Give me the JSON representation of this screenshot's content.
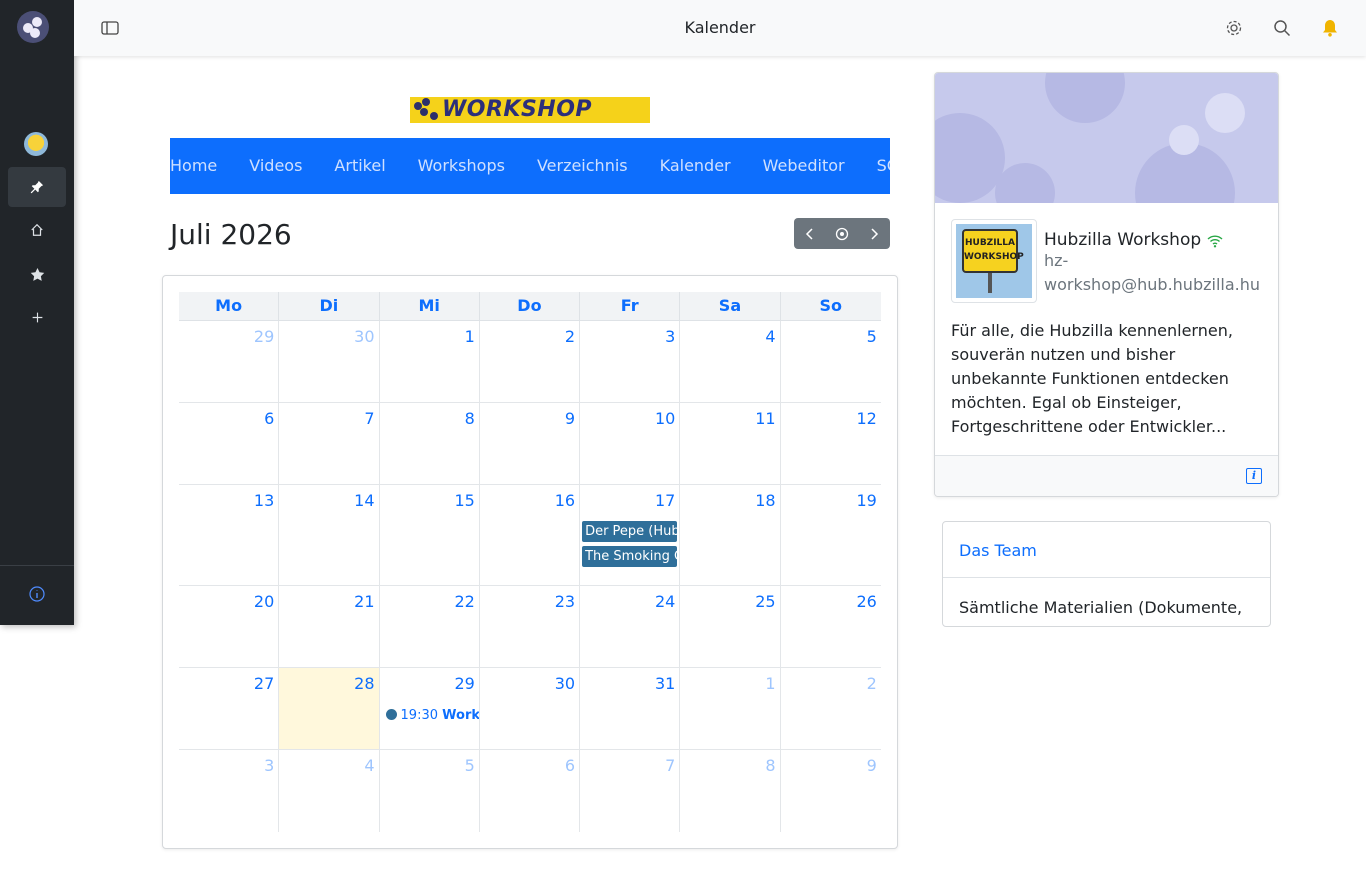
{
  "topbar": {
    "title": "Kalender"
  },
  "banner": {
    "text": "WORKSHOP"
  },
  "nav": {
    "items": [
      "Home",
      "Videos",
      "Artikel",
      "Workshops",
      "Verzeichnis",
      "Kalender",
      "Webeditor",
      "SCEd"
    ]
  },
  "calendar": {
    "month_title": "Juli 2026",
    "weekdays": [
      "Mo",
      "Di",
      "Mi",
      "Do",
      "Fr",
      "Sa",
      "So"
    ],
    "weeks": [
      [
        {
          "d": "29",
          "o": true
        },
        {
          "d": "30",
          "o": true
        },
        {
          "d": "1"
        },
        {
          "d": "2"
        },
        {
          "d": "3"
        },
        {
          "d": "4"
        },
        {
          "d": "5"
        }
      ],
      [
        {
          "d": "6"
        },
        {
          "d": "7"
        },
        {
          "d": "8"
        },
        {
          "d": "9"
        },
        {
          "d": "10"
        },
        {
          "d": "11"
        },
        {
          "d": "12"
        }
      ],
      [
        {
          "d": "13"
        },
        {
          "d": "14"
        },
        {
          "d": "15"
        },
        {
          "d": "16"
        },
        {
          "d": "17",
          "events": [
            "Der Pepe (Hub",
            "The Smoking C"
          ]
        },
        {
          "d": "18"
        },
        {
          "d": "19"
        }
      ],
      [
        {
          "d": "20"
        },
        {
          "d": "21"
        },
        {
          "d": "22"
        },
        {
          "d": "23"
        },
        {
          "d": "24"
        },
        {
          "d": "25"
        },
        {
          "d": "26"
        }
      ],
      [
        {
          "d": "27"
        },
        {
          "d": "28",
          "today": true
        },
        {
          "d": "29",
          "dot": {
            "time": "19:30",
            "title": "Works"
          }
        },
        {
          "d": "30"
        },
        {
          "d": "31"
        },
        {
          "d": "1",
          "o": true
        },
        {
          "d": "2",
          "o": true
        }
      ],
      [
        {
          "d": "3",
          "o": true
        },
        {
          "d": "4",
          "o": true
        },
        {
          "d": "5",
          "o": true
        },
        {
          "d": "6",
          "o": true
        },
        {
          "d": "7",
          "o": true
        },
        {
          "d": "8",
          "o": true
        },
        {
          "d": "9",
          "o": true
        }
      ]
    ]
  },
  "profile": {
    "sign_text": "HUBZILLA WORKSHOP",
    "name": "Hubzilla Workshop",
    "handle": "hz-workshop@hub.hubzilla.hu",
    "description": "Für alle, die Hubzilla kennenlernen, souverän nutzen und bisher unbekannte Funktionen entdecken möchten. Egal ob Einsteiger, Fortgeschrittene oder Entwickler...",
    "info_label": "i"
  },
  "team": {
    "title": "Das Team",
    "text": "Sämtliche Materialien (Dokumente,"
  },
  "colors": {
    "primary": "#0d6efd",
    "rail": "#212529",
    "event": "#2f6f9a",
    "today": "#fff8dc"
  }
}
